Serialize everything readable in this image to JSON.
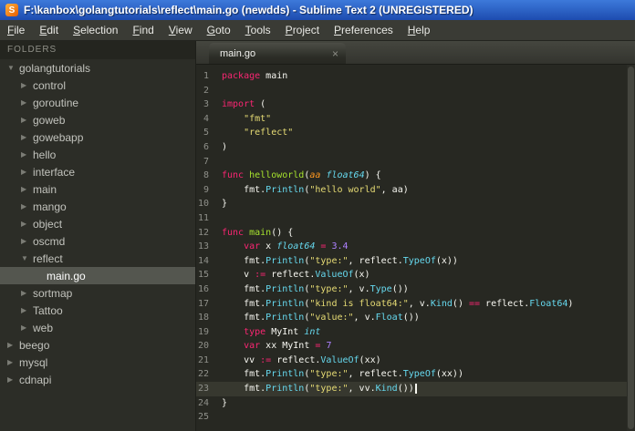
{
  "window": {
    "title": "F:\\kanbox\\golangtutorials\\reflect\\main.go (newdds) - Sublime Text 2 (UNREGISTERED)",
    "app_icon_glyph": "S"
  },
  "menu": {
    "items": [
      "File",
      "Edit",
      "Selection",
      "Find",
      "View",
      "Goto",
      "Tools",
      "Project",
      "Preferences",
      "Help"
    ]
  },
  "sidebar": {
    "header": "FOLDERS",
    "items": [
      {
        "label": "golangtutorials",
        "level": 0,
        "kind": "folder",
        "state": "expanded",
        "selected": false
      },
      {
        "label": "control",
        "level": 1,
        "kind": "folder",
        "state": "collapsed",
        "selected": false
      },
      {
        "label": "goroutine",
        "level": 1,
        "kind": "folder",
        "state": "collapsed",
        "selected": false
      },
      {
        "label": "goweb",
        "level": 1,
        "kind": "folder",
        "state": "collapsed",
        "selected": false
      },
      {
        "label": "gowebapp",
        "level": 1,
        "kind": "folder",
        "state": "collapsed",
        "selected": false
      },
      {
        "label": "hello",
        "level": 1,
        "kind": "folder",
        "state": "collapsed",
        "selected": false
      },
      {
        "label": "interface",
        "level": 1,
        "kind": "folder",
        "state": "collapsed",
        "selected": false
      },
      {
        "label": "main",
        "level": 1,
        "kind": "folder",
        "state": "collapsed",
        "selected": false
      },
      {
        "label": "mango",
        "level": 1,
        "kind": "folder",
        "state": "collapsed",
        "selected": false
      },
      {
        "label": "object",
        "level": 1,
        "kind": "folder",
        "state": "collapsed",
        "selected": false
      },
      {
        "label": "oscmd",
        "level": 1,
        "kind": "folder",
        "state": "collapsed",
        "selected": false
      },
      {
        "label": "reflect",
        "level": 1,
        "kind": "folder",
        "state": "expanded",
        "selected": false
      },
      {
        "label": "main.go",
        "level": 2,
        "kind": "file",
        "state": "none",
        "selected": true
      },
      {
        "label": "sortmap",
        "level": 1,
        "kind": "folder",
        "state": "collapsed",
        "selected": false
      },
      {
        "label": "Tattoo",
        "level": 1,
        "kind": "folder",
        "state": "collapsed",
        "selected": false
      },
      {
        "label": "web",
        "level": 1,
        "kind": "folder",
        "state": "collapsed",
        "selected": false
      },
      {
        "label": "beego",
        "level": 0,
        "kind": "folder",
        "state": "collapsed",
        "selected": false
      },
      {
        "label": "mysql",
        "level": 0,
        "kind": "folder",
        "state": "collapsed",
        "selected": false
      },
      {
        "label": "cdnapi",
        "level": 0,
        "kind": "folder",
        "state": "collapsed",
        "selected": false
      }
    ]
  },
  "editor": {
    "tab": {
      "label": "main.go",
      "close_glyph": "×"
    },
    "language": "go",
    "active_line": 23,
    "lines": [
      {
        "n": 1,
        "seg": [
          [
            "kw",
            "package"
          ],
          [
            "pl",
            " main"
          ]
        ]
      },
      {
        "n": 2,
        "seg": []
      },
      {
        "n": 3,
        "seg": [
          [
            "kw",
            "import"
          ],
          [
            "pl",
            " ("
          ]
        ]
      },
      {
        "n": 4,
        "seg": [
          [
            "pl",
            "    "
          ],
          [
            "str",
            "\"fmt\""
          ]
        ]
      },
      {
        "n": 5,
        "seg": [
          [
            "pl",
            "    "
          ],
          [
            "str",
            "\"reflect\""
          ]
        ]
      },
      {
        "n": 6,
        "seg": [
          [
            "pl",
            ")"
          ]
        ]
      },
      {
        "n": 7,
        "seg": []
      },
      {
        "n": 8,
        "seg": [
          [
            "kw",
            "func"
          ],
          [
            "pl",
            " "
          ],
          [
            "decl",
            "helloworld"
          ],
          [
            "pl",
            "("
          ],
          [
            "param",
            "aa"
          ],
          [
            "pl",
            " "
          ],
          [
            "type",
            "float64"
          ],
          [
            "pl",
            ") {"
          ]
        ]
      },
      {
        "n": 9,
        "seg": [
          [
            "pl",
            "    fmt."
          ],
          [
            "fn",
            "Println"
          ],
          [
            "pl",
            "("
          ],
          [
            "str",
            "\"hello world\""
          ],
          [
            "pl",
            ", aa)"
          ]
        ]
      },
      {
        "n": 10,
        "seg": [
          [
            "pl",
            "}"
          ]
        ]
      },
      {
        "n": 11,
        "seg": []
      },
      {
        "n": 12,
        "seg": [
          [
            "kw",
            "func"
          ],
          [
            "pl",
            " "
          ],
          [
            "decl",
            "main"
          ],
          [
            "pl",
            "() {"
          ]
        ]
      },
      {
        "n": 13,
        "seg": [
          [
            "pl",
            "    "
          ],
          [
            "kw",
            "var"
          ],
          [
            "pl",
            " x "
          ],
          [
            "type",
            "float64"
          ],
          [
            "pl",
            " "
          ],
          [
            "kw",
            "="
          ],
          [
            "pl",
            " "
          ],
          [
            "num",
            "3.4"
          ]
        ]
      },
      {
        "n": 14,
        "seg": [
          [
            "pl",
            "    fmt."
          ],
          [
            "fn",
            "Println"
          ],
          [
            "pl",
            "("
          ],
          [
            "str",
            "\"type:\""
          ],
          [
            "pl",
            ", reflect."
          ],
          [
            "fn",
            "TypeOf"
          ],
          [
            "pl",
            "(x))"
          ]
        ]
      },
      {
        "n": 15,
        "seg": [
          [
            "pl",
            "    v "
          ],
          [
            "kw",
            ":="
          ],
          [
            "pl",
            " reflect."
          ],
          [
            "fn",
            "ValueOf"
          ],
          [
            "pl",
            "(x)"
          ]
        ]
      },
      {
        "n": 16,
        "seg": [
          [
            "pl",
            "    fmt."
          ],
          [
            "fn",
            "Println"
          ],
          [
            "pl",
            "("
          ],
          [
            "str",
            "\"type:\""
          ],
          [
            "pl",
            ", v."
          ],
          [
            "fn",
            "Type"
          ],
          [
            "pl",
            "())"
          ]
        ]
      },
      {
        "n": 17,
        "seg": [
          [
            "pl",
            "    fmt."
          ],
          [
            "fn",
            "Println"
          ],
          [
            "pl",
            "("
          ],
          [
            "str",
            "\"kind is float64:\""
          ],
          [
            "pl",
            ", v."
          ],
          [
            "fn",
            "Kind"
          ],
          [
            "pl",
            "() "
          ],
          [
            "kw",
            "=="
          ],
          [
            "pl",
            " reflect."
          ],
          [
            "fn",
            "Float64"
          ],
          [
            "pl",
            ")"
          ]
        ]
      },
      {
        "n": 18,
        "seg": [
          [
            "pl",
            "    fmt."
          ],
          [
            "fn",
            "Println"
          ],
          [
            "pl",
            "("
          ],
          [
            "str",
            "\"value:\""
          ],
          [
            "pl",
            ", v."
          ],
          [
            "fn",
            "Float"
          ],
          [
            "pl",
            "())"
          ]
        ]
      },
      {
        "n": 19,
        "seg": [
          [
            "pl",
            "    "
          ],
          [
            "kw",
            "type"
          ],
          [
            "pl",
            " MyInt "
          ],
          [
            "type",
            "int"
          ]
        ]
      },
      {
        "n": 20,
        "seg": [
          [
            "pl",
            "    "
          ],
          [
            "kw",
            "var"
          ],
          [
            "pl",
            " xx MyInt "
          ],
          [
            "kw",
            "="
          ],
          [
            "pl",
            " "
          ],
          [
            "num",
            "7"
          ]
        ]
      },
      {
        "n": 21,
        "seg": [
          [
            "pl",
            "    vv "
          ],
          [
            "kw",
            ":="
          ],
          [
            "pl",
            " reflect."
          ],
          [
            "fn",
            "ValueOf"
          ],
          [
            "pl",
            "(xx)"
          ]
        ]
      },
      {
        "n": 22,
        "seg": [
          [
            "pl",
            "    fmt."
          ],
          [
            "fn",
            "Println"
          ],
          [
            "pl",
            "("
          ],
          [
            "str",
            "\"type:\""
          ],
          [
            "pl",
            ", reflect."
          ],
          [
            "fn",
            "TypeOf"
          ],
          [
            "pl",
            "(xx))"
          ]
        ]
      },
      {
        "n": 23,
        "seg": [
          [
            "pl",
            "    fmt."
          ],
          [
            "fn",
            "Println"
          ],
          [
            "pl",
            "("
          ],
          [
            "str",
            "\"type:\""
          ],
          [
            "pl",
            ", vv."
          ],
          [
            "fn",
            "Kind"
          ],
          [
            "pl",
            "())"
          ]
        ]
      },
      {
        "n": 24,
        "seg": [
          [
            "pl",
            "}"
          ]
        ]
      },
      {
        "n": 25,
        "seg": []
      }
    ]
  },
  "colors": {
    "titlebar_blue": "#2a5ccd",
    "editor_bg": "#272822",
    "sidebar_bg": "#2c2d27",
    "selected_row_bg": "#54564f",
    "active_line_bg": "#37382f",
    "keyword": "#f92672",
    "string": "#e6db74",
    "function_call": "#66d9ef",
    "type": "#66d9ef",
    "number": "#ae81ff",
    "declaration": "#a6e22e",
    "parameter": "#fd971f",
    "plain_text": "#f8f8f2",
    "line_number": "#8f908a"
  }
}
